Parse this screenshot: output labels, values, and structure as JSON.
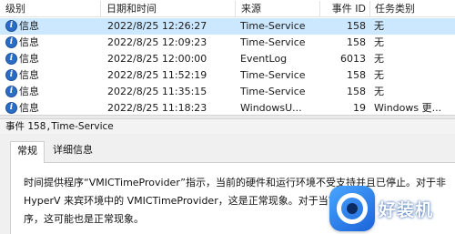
{
  "columns": {
    "level": "级别",
    "date": "日期和时间",
    "source": "来源",
    "event_id": "事件 ID",
    "task": "任务类别"
  },
  "events": [
    {
      "level": "信息",
      "date": "2022/8/25 12:26:27",
      "source": "Time-Service",
      "event_id": "158",
      "task": "无"
    },
    {
      "level": "信息",
      "date": "2022/8/25 12:09:23",
      "source": "Time-Service",
      "event_id": "158",
      "task": "无"
    },
    {
      "level": "信息",
      "date": "2022/8/25 12:00:00",
      "source": "EventLog",
      "event_id": "6013",
      "task": "无"
    },
    {
      "level": "信息",
      "date": "2022/8/25 11:52:19",
      "source": "Time-Service",
      "event_id": "158",
      "task": "无"
    },
    {
      "level": "信息",
      "date": "2022/8/25 11:35:15",
      "source": "Time-Service",
      "event_id": "158",
      "task": "无"
    },
    {
      "level": "信息",
      "date": "2022/8/25 11:18:23",
      "source": "WindowsU...",
      "event_id": "19",
      "task": "Windows 更..."
    }
  ],
  "detail": {
    "title_prefix": "事件 158",
    "title_separator": ",",
    "title_source": "Time-Service",
    "tabs": [
      "常规",
      "详细信息"
    ],
    "description_lines": [
      "时间提供程序“VMICTimeProvider”指示，当前的硬件和运行环境不受支持并且已停止。对于非",
      "HyperV 来宾环境中的 VMICTimeProvider，这是正常现象。对于当前操作",
      "序，这可能也是正常现象。"
    ]
  },
  "watermark": {
    "text": "好装机"
  },
  "colors": {
    "selected_row": "#cce8ff",
    "info_icon": "#2b6cc4",
    "watermark": "#1b63d8"
  }
}
